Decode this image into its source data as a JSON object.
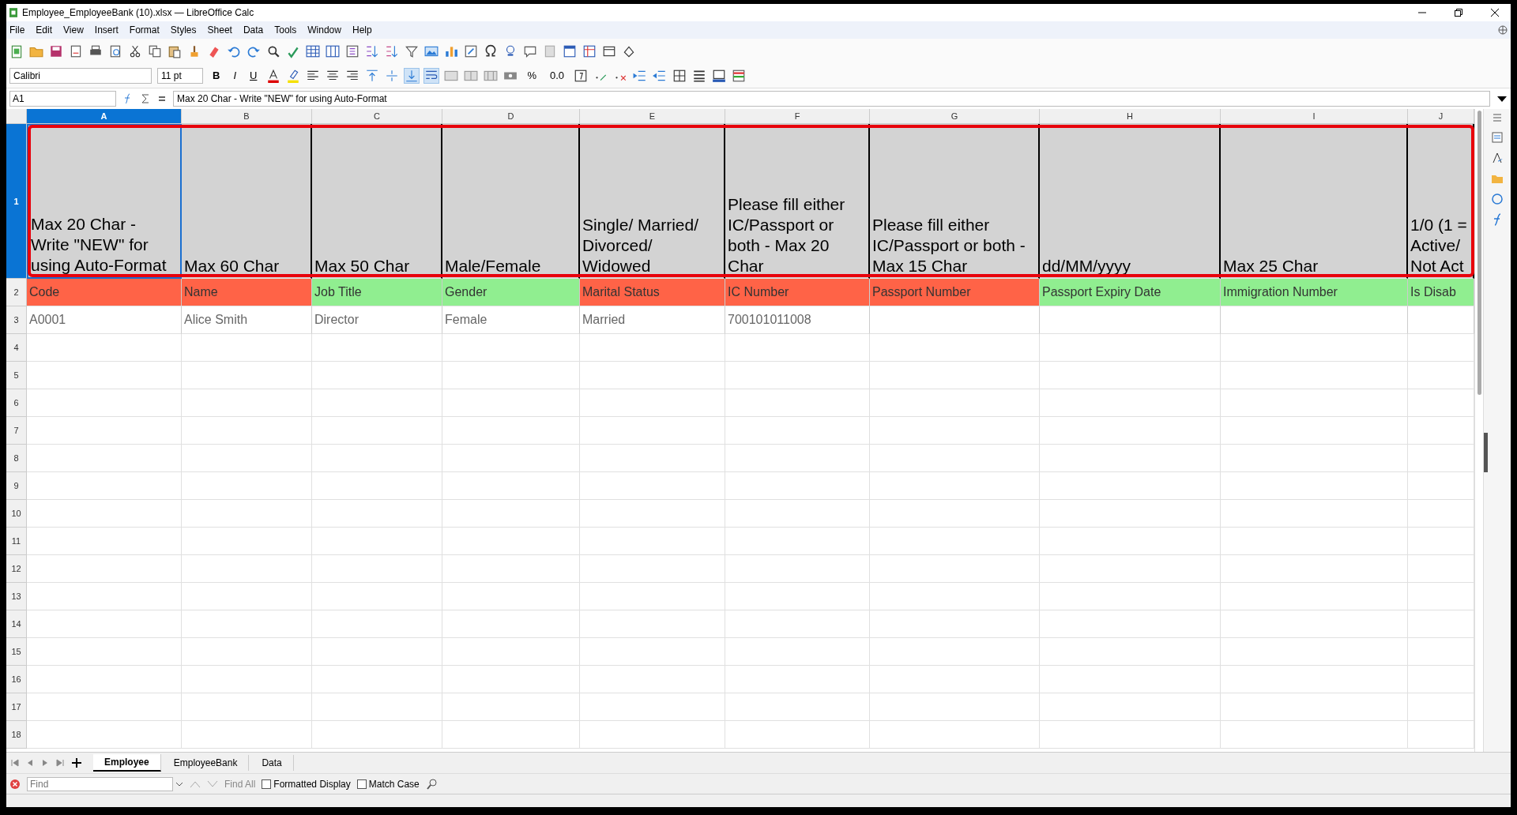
{
  "window": {
    "title": "Employee_EmployeeBank (10).xlsx — LibreOffice Calc"
  },
  "menu": [
    "File",
    "Edit",
    "View",
    "Insert",
    "Format",
    "Styles",
    "Sheet",
    "Data",
    "Tools",
    "Window",
    "Help"
  ],
  "toolbar": {
    "font_name": "Calibri",
    "font_size": "11 pt",
    "style_buttons": [
      "B",
      "I",
      "U"
    ],
    "number_buttons": [
      "%",
      "0.0"
    ]
  },
  "formula_bar": {
    "cell_ref": "A1",
    "content": "Max 20 Char - Write \"NEW\" for using Auto-Format"
  },
  "columns": [
    {
      "label": "A",
      "selected": true
    },
    {
      "label": "B",
      "selected": false
    },
    {
      "label": "C",
      "selected": false
    },
    {
      "label": "D",
      "selected": false
    },
    {
      "label": "E",
      "selected": false
    },
    {
      "label": "F",
      "selected": false
    },
    {
      "label": "G",
      "selected": false
    },
    {
      "label": "H",
      "selected": false
    },
    {
      "label": "I",
      "selected": false
    },
    {
      "label": "J",
      "selected": false
    }
  ],
  "rows": [
    {
      "number": "1",
      "selected": true,
      "kind": "header",
      "cells": [
        {
          "text": "Max 20 Char - Write \"NEW\" for using Auto-Format"
        },
        {
          "text": "Max 60 Char"
        },
        {
          "text": "Max 50 Char"
        },
        {
          "text": "Male/Female"
        },
        {
          "text": "Single/ Married/ Divorced/ Widowed"
        },
        {
          "text": "Please fill either IC/Passport or both - Max 20 Char"
        },
        {
          "text": "Please fill either IC/Passport or both - Max 15 Char"
        },
        {
          "text": "dd/MM/yyyy"
        },
        {
          "text": "Max 25 Char"
        },
        {
          "text": "1/0 (1 = Active/ Not Act"
        }
      ]
    },
    {
      "number": "2",
      "selected": false,
      "kind": "data",
      "cells": [
        {
          "text": "Code",
          "color": "#ff6347"
        },
        {
          "text": "Name",
          "color": "#ff6347"
        },
        {
          "text": "Job Title",
          "color": "#90ee90"
        },
        {
          "text": "Gender",
          "color": "#90ee90"
        },
        {
          "text": "Marital Status",
          "color": "#ff6347"
        },
        {
          "text": "IC Number",
          "color": "#ff6347"
        },
        {
          "text": "Passport Number",
          "color": "#ff6347"
        },
        {
          "text": "Passport Expiry Date",
          "color": "#90ee90"
        },
        {
          "text": "Immigration Number",
          "color": "#90ee90"
        },
        {
          "text": "Is Disab",
          "color": "#90ee90"
        }
      ]
    },
    {
      "number": "3",
      "selected": false,
      "kind": "data",
      "cells": [
        {
          "text": "A0001"
        },
        {
          "text": "Alice Smith"
        },
        {
          "text": "Director"
        },
        {
          "text": "Female"
        },
        {
          "text": "Married"
        },
        {
          "text": "700101011008"
        },
        {
          "text": ""
        },
        {
          "text": ""
        },
        {
          "text": ""
        },
        {
          "text": ""
        }
      ]
    },
    {
      "number": "4",
      "selected": false,
      "kind": "empty"
    },
    {
      "number": "5",
      "selected": false,
      "kind": "empty"
    },
    {
      "number": "6",
      "selected": false,
      "kind": "empty"
    },
    {
      "number": "7",
      "selected": false,
      "kind": "empty"
    },
    {
      "number": "8",
      "selected": false,
      "kind": "empty"
    },
    {
      "number": "9",
      "selected": false,
      "kind": "empty"
    },
    {
      "number": "10",
      "selected": false,
      "kind": "empty"
    },
    {
      "number": "11",
      "selected": false,
      "kind": "empty"
    },
    {
      "number": "12",
      "selected": false,
      "kind": "empty"
    },
    {
      "number": "13",
      "selected": false,
      "kind": "empty"
    },
    {
      "number": "14",
      "selected": false,
      "kind": "empty"
    },
    {
      "number": "15",
      "selected": false,
      "kind": "empty"
    },
    {
      "number": "16",
      "selected": false,
      "kind": "empty"
    },
    {
      "number": "17",
      "selected": false,
      "kind": "empty"
    },
    {
      "number": "18",
      "selected": false,
      "kind": "empty"
    }
  ],
  "sheet_tabs": [
    {
      "label": "Employee",
      "selected": true
    },
    {
      "label": "EmployeeBank",
      "selected": false
    },
    {
      "label": "Data",
      "selected": false
    }
  ],
  "find_bar": {
    "placeholder": "Find",
    "find_all": "Find All",
    "options": [
      {
        "label": "Formatted Display",
        "checked": false
      },
      {
        "label": "Match Case",
        "checked": false
      }
    ]
  }
}
